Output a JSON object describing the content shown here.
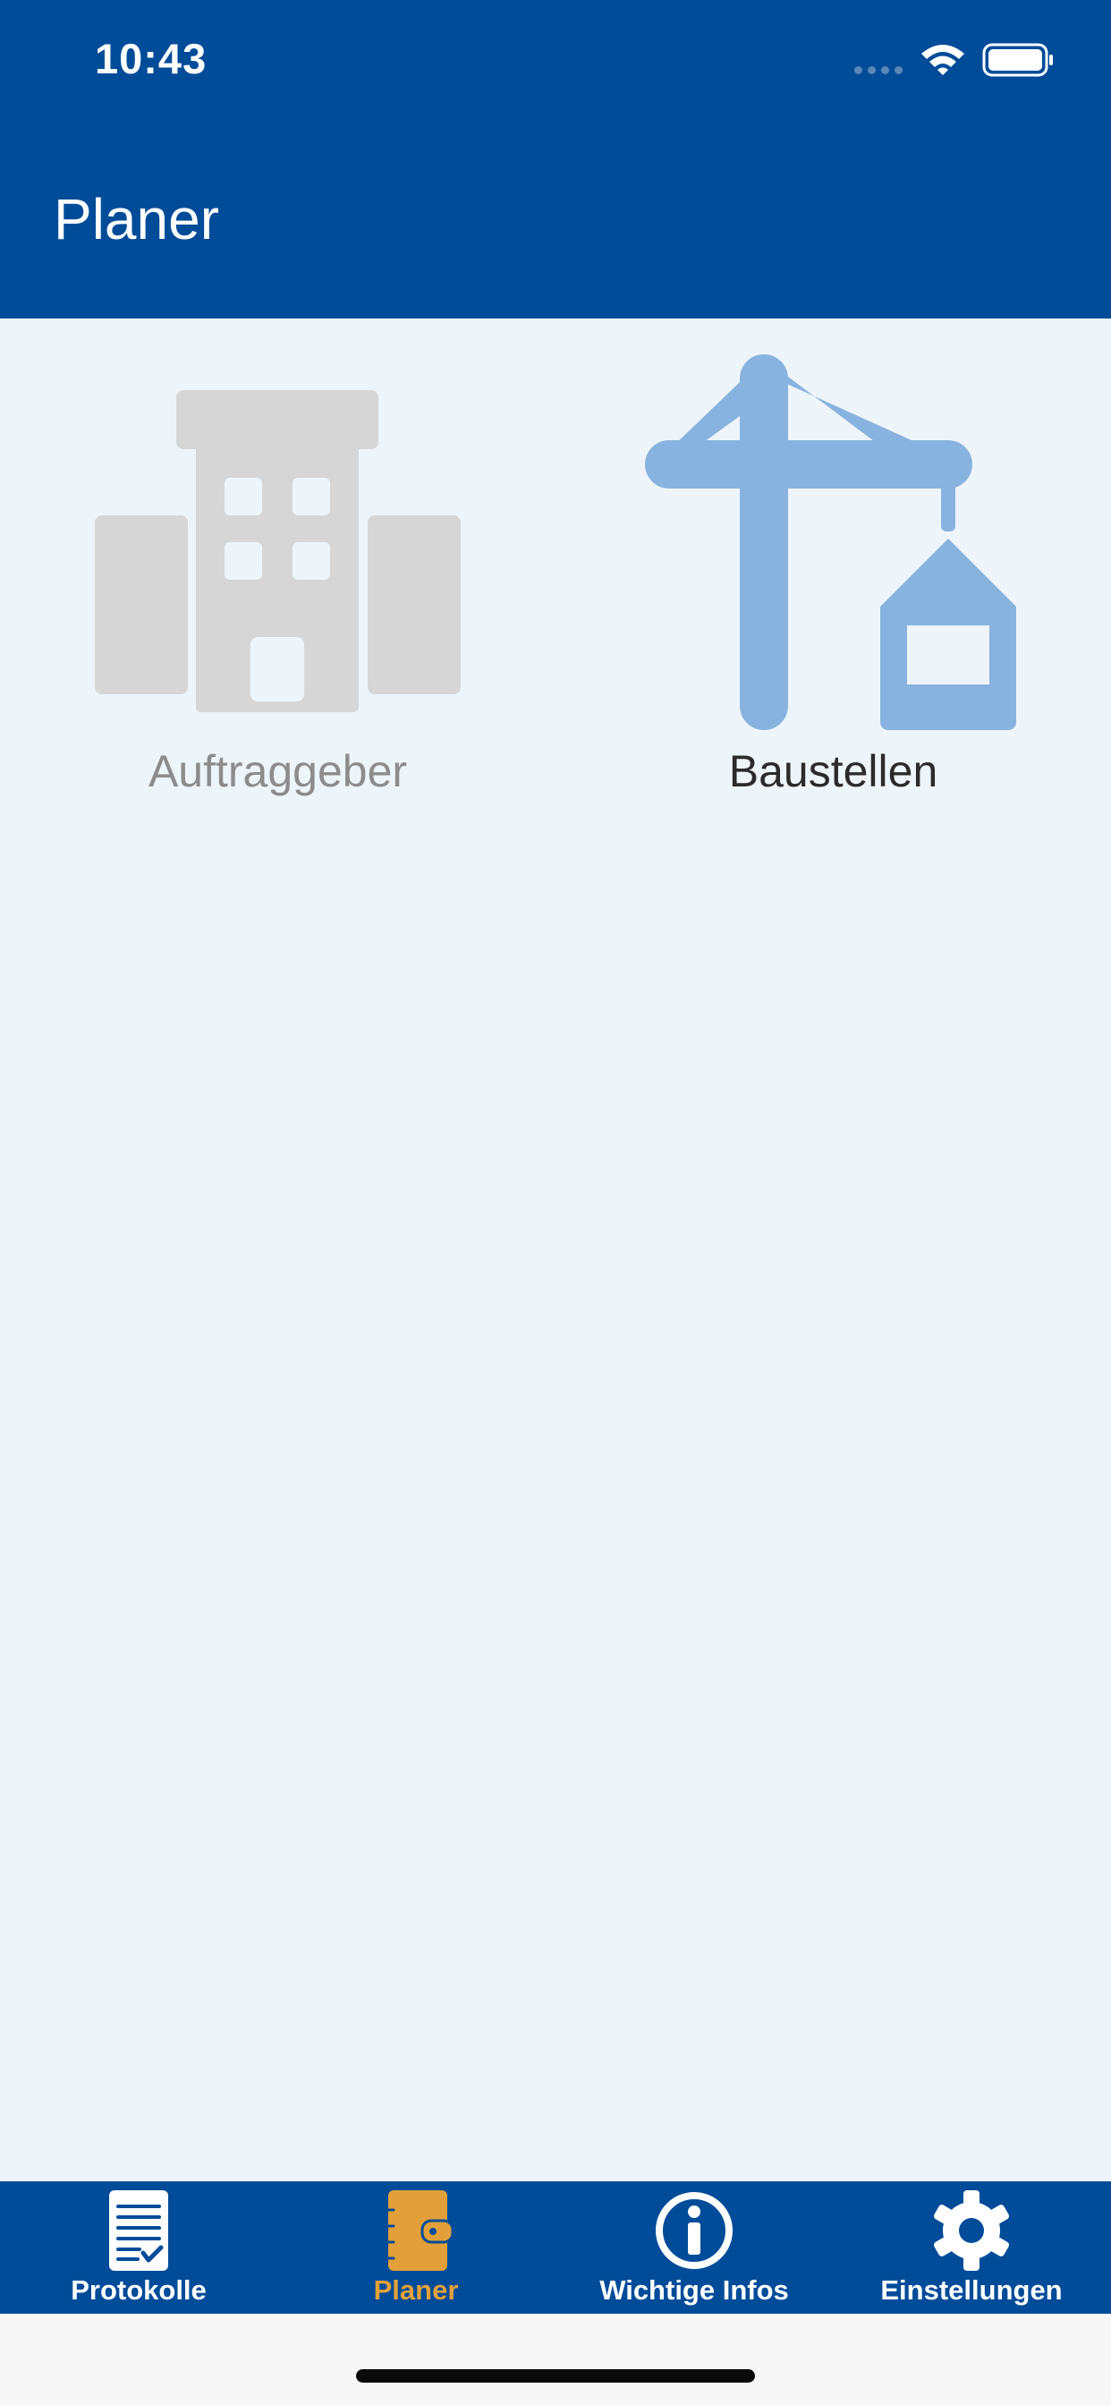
{
  "status_bar": {
    "time": "10:43"
  },
  "header": {
    "title": "Planer",
    "background": "#004C99"
  },
  "tiles": [
    {
      "label": "Auftraggeber",
      "icon": "office-building-icon",
      "state": "disabled",
      "color": "#D6D6D6"
    },
    {
      "label": "Baustellen",
      "icon": "construction-crane-icon",
      "state": "enabled",
      "color": "#88B3E0"
    }
  ],
  "tabbar": {
    "items": [
      {
        "label": "Protokolle",
        "icon": "document-checklist-icon"
      },
      {
        "label": "Planer",
        "icon": "planner-notebook-icon",
        "active": true,
        "active_color": "#E3A03A"
      },
      {
        "label": "Wichtige Infos",
        "icon": "info-icon"
      },
      {
        "label": "Einstellungen",
        "icon": "gear-icon"
      }
    ]
  },
  "colors": {
    "content_background": "#EEF5FA",
    "tabbar_background": "#004C99"
  }
}
